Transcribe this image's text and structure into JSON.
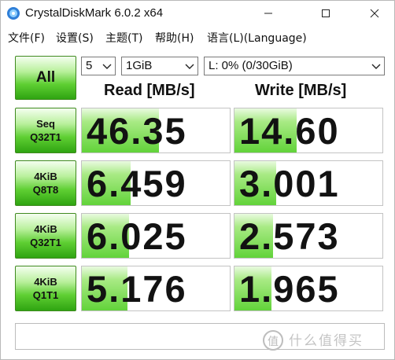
{
  "window": {
    "title": "CrystalDiskMark 6.0.2 x64",
    "colors": {
      "accent_green": "#3fbf1f",
      "text": "#111111"
    }
  },
  "menu": {
    "items": [
      "文件(F)",
      "设置(S)",
      "主题(T)",
      "帮助(H)",
      "语言(L)(Language)"
    ]
  },
  "controls": {
    "all_label": "All",
    "count_value": "5",
    "size_value": "1GiB",
    "drive_value": "L: 0% (0/30GiB)"
  },
  "headers": {
    "read": "Read [MB/s]",
    "write": "Write [MB/s]"
  },
  "tests": [
    {
      "line1": "Seq",
      "line2": "Q32T1",
      "read": "46.35",
      "write": "14.60",
      "read_level": 0.52,
      "write_level": 0.42
    },
    {
      "line1": "4KiB",
      "line2": "Q8T8",
      "read": "6.459",
      "write": "3.001",
      "read_level": 0.33,
      "write_level": 0.28
    },
    {
      "line1": "4KiB",
      "line2": "Q32T1",
      "read": "6.025",
      "write": "2.573",
      "read_level": 0.32,
      "write_level": 0.26
    },
    {
      "line1": "4KiB",
      "line2": "Q1T1",
      "read": "5.176",
      "write": "1.965",
      "read_level": 0.31,
      "write_level": 0.25
    }
  ],
  "comment": {
    "value": ""
  },
  "watermark": {
    "text": "值 什么值得买",
    "icon": "watermark-logo-icon"
  }
}
